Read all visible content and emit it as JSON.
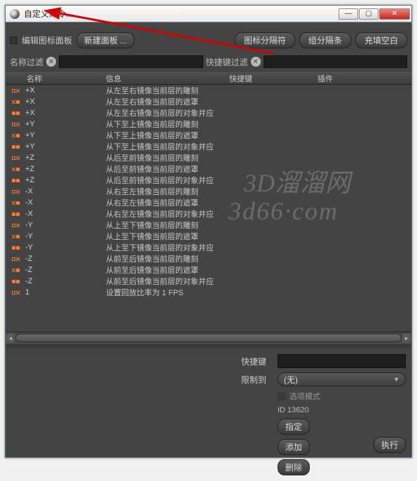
{
  "window": {
    "title": "自定义命令..."
  },
  "toolbar": {
    "edit_palette_label": "编辑图标面板",
    "new_panel_label": "新建面板 ...",
    "icon_sep_label": "图标分隔符",
    "group_sep_label": "组分隔条",
    "fill_blank_label": "充填空白"
  },
  "filter": {
    "name_label": "名称过滤",
    "name_value": "",
    "shortcut_label": "快捷键过滤",
    "shortcut_value": ""
  },
  "columns": {
    "name": "名称",
    "info": "信息",
    "shortcut": "快捷键",
    "plugin": "插件"
  },
  "rows": [
    {
      "name": "+X",
      "info": "从左至右镜像当前层的雕刻"
    },
    {
      "name": "+X",
      "info": "从左至右镜像当前层的遮罩"
    },
    {
      "name": "+X",
      "info": "从左至右镜像当前层的对象并应"
    },
    {
      "name": "+Y",
      "info": "从下至上镜像当前层的雕刻"
    },
    {
      "name": "+Y",
      "info": "从下至上镜像当前层的遮罩"
    },
    {
      "name": "+Y",
      "info": "从下至上镜像当前层的对象并应"
    },
    {
      "name": "+Z",
      "info": "从后至前镜像当前层的雕刻"
    },
    {
      "name": "+Z",
      "info": "从后至前镜像当前层的遮罩"
    },
    {
      "name": "+Z",
      "info": "从后至前镜像当前层的对象并应"
    },
    {
      "name": "-X",
      "info": "从右至左镜像当前层的雕刻"
    },
    {
      "name": "-X",
      "info": "从右至左镜像当前层的遮罩"
    },
    {
      "name": "-X",
      "info": "从右至左镜像当前层的对象并应"
    },
    {
      "name": "-Y",
      "info": "从上至下镜像当前层的雕刻"
    },
    {
      "name": "-Y",
      "info": "从上至下镜像当前层的遮罩"
    },
    {
      "name": "-Y",
      "info": "从上至下镜像当前层的对象并应"
    },
    {
      "name": "-Z",
      "info": "从前至后镜像当前层的雕刻"
    },
    {
      "name": "-Z",
      "info": "从前至后镜像当前层的遮罩"
    },
    {
      "name": "-Z",
      "info": "从前至后镜像当前层的对象并应"
    },
    {
      "name": "1",
      "info": "设置回放比率为 1 FPS"
    }
  ],
  "detail": {
    "shortcut_label": "快捷键",
    "shortcut_value": "",
    "restrict_label": "限制到",
    "restrict_value": "(无)",
    "option_mode_label": "选项模式",
    "id_label": "ID 13620",
    "assign_btn": "指定",
    "add_btn": "添加",
    "delete_btn": "删除",
    "execute_btn": "执行"
  },
  "watermark": {
    "line1": "3D溜溜网",
    "line2": "3d66·com"
  }
}
